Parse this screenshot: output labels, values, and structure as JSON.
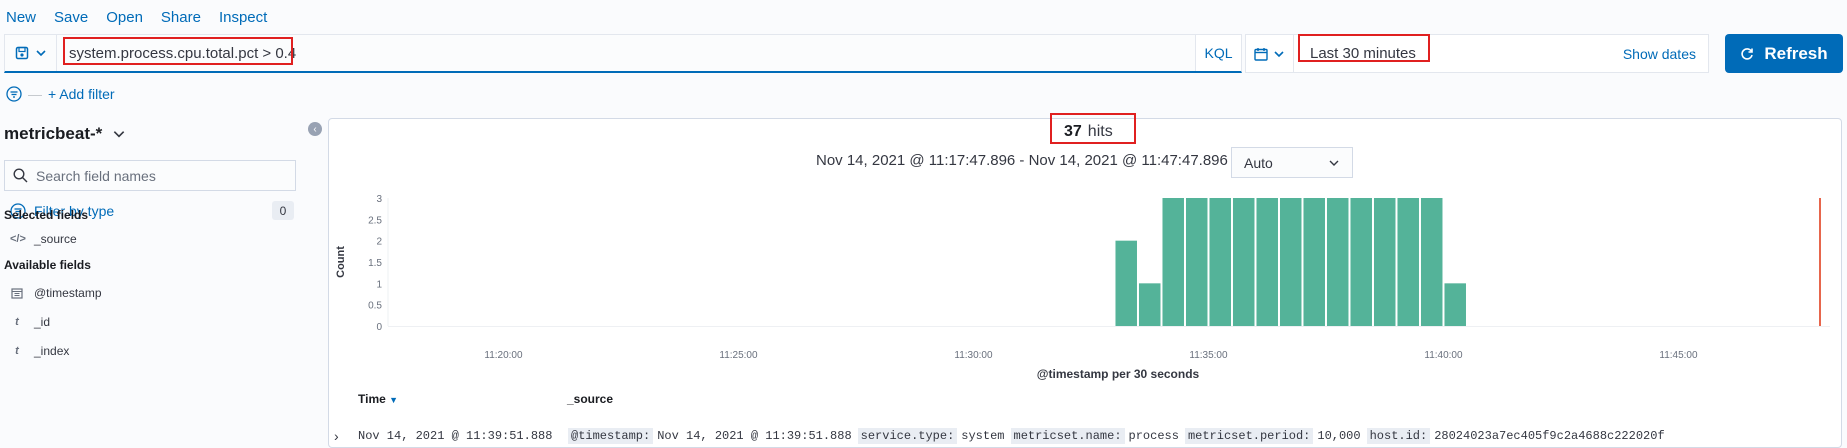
{
  "nav": {
    "items": [
      "New",
      "Save",
      "Open",
      "Share",
      "Inspect"
    ]
  },
  "query": {
    "text": "system.process.cpu.total.pct > 0.4",
    "language": "KQL"
  },
  "date_picker": {
    "range": "Last 30 minutes",
    "show_dates": "Show dates"
  },
  "refresh_label": "Refresh",
  "add_filter": "+ Add filter",
  "sidebar": {
    "index_pattern": "metricbeat-*",
    "search_placeholder": "Search field names",
    "filter_by_type": "Filter by type",
    "filter_count": "0",
    "selected_title": "Selected fields",
    "selected_fields": [
      {
        "icon": "code-icon",
        "name": "_source"
      }
    ],
    "available_title": "Available fields",
    "available_fields": [
      {
        "icon": "calendar-icon",
        "name": "@timestamp"
      },
      {
        "icon": "text-type-icon",
        "name": "_id"
      },
      {
        "icon": "text-type-icon",
        "name": "_index"
      }
    ]
  },
  "hits": {
    "count": "37",
    "label": "hits"
  },
  "time_range": "Nov 14, 2021 @ 11:17:47.896 - Nov 14, 2021 @ 11:47:47.896 —",
  "interval": "Auto",
  "colors": {
    "accent": "#006bb8",
    "bar": "#54b399",
    "marker": "#e7664c",
    "highlight": "#e02020"
  },
  "chart_data": {
    "type": "bar",
    "xlabel": "@timestamp per 30 seconds",
    "ylabel": "Count",
    "ylim": [
      0,
      3
    ],
    "y_ticks": [
      "0",
      "0.5",
      "1",
      "1.5",
      "2",
      "2.5",
      "3"
    ],
    "x_ticks": [
      "11:20:00",
      "11:25:00",
      "11:30:00",
      "11:35:00",
      "11:40:00",
      "11:45:00"
    ],
    "categories": [
      "11:33:00",
      "11:33:30",
      "11:34:00",
      "11:34:30",
      "11:35:00",
      "11:35:30",
      "11:36:00",
      "11:36:30",
      "11:37:00",
      "11:37:30",
      "11:38:00",
      "11:38:30",
      "11:39:00",
      "11:39:30",
      "11:40:00"
    ],
    "values": [
      2,
      1,
      3,
      3,
      3,
      3,
      3,
      3,
      3,
      3,
      3,
      3,
      3,
      3,
      1
    ]
  },
  "table": {
    "col_time": "Time",
    "col_source": "_source",
    "rows": [
      {
        "time": "Nov 14, 2021 @ 11:39:51.888",
        "fields": [
          {
            "k": "@timestamp:",
            "v": "Nov 14, 2021 @ 11:39:51.888"
          },
          {
            "k": "service.type:",
            "v": "system"
          },
          {
            "k": "metricset.name:",
            "v": "process"
          },
          {
            "k": "metricset.period:",
            "v": "10,000"
          },
          {
            "k": "host.id:",
            "v": "28024023a7ec405f9c2a4688c222020f"
          }
        ]
      }
    ]
  }
}
